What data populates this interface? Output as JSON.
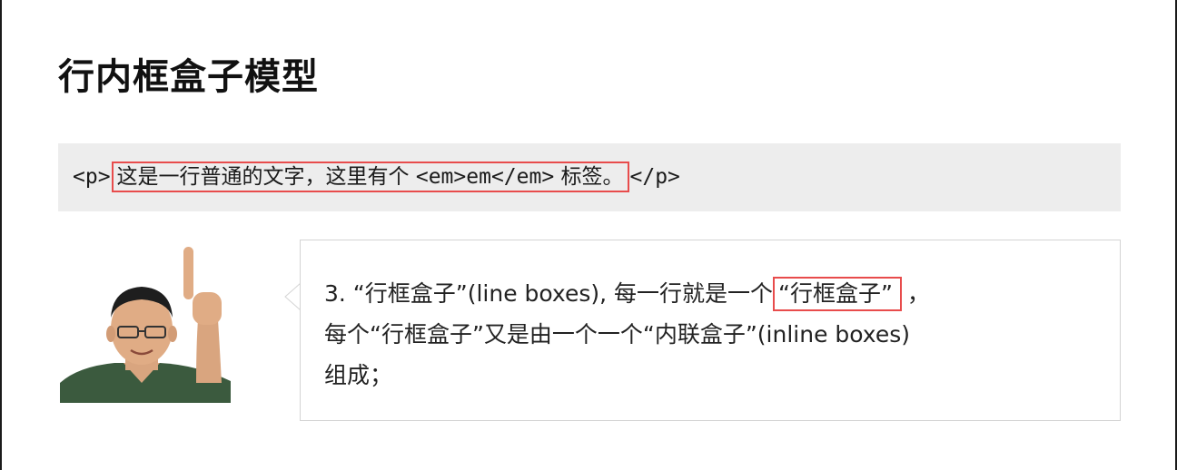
{
  "slide": {
    "title": "行内框盒子模型"
  },
  "code": {
    "open_tag": "<p>",
    "highlighted_text": "这是一行普通的文字，这里有个",
    "em_code": "<em>em</em>",
    "highlighted_tail": "标签。",
    "close_tag": "</p>"
  },
  "explanation": {
    "line1_prefix": "3. “行框盒子”(line boxes), 每一行就是一个",
    "line1_highlight": "“行框盒子”",
    "line1_suffix": "，",
    "line2": "每个“行框盒子”又是由一个一个“内联盒子”(inline boxes)",
    "line3": "组成；"
  },
  "colors": {
    "highlight_border": "#e84c4c",
    "code_background": "#ededed",
    "bubble_border": "#d4d4d4"
  }
}
